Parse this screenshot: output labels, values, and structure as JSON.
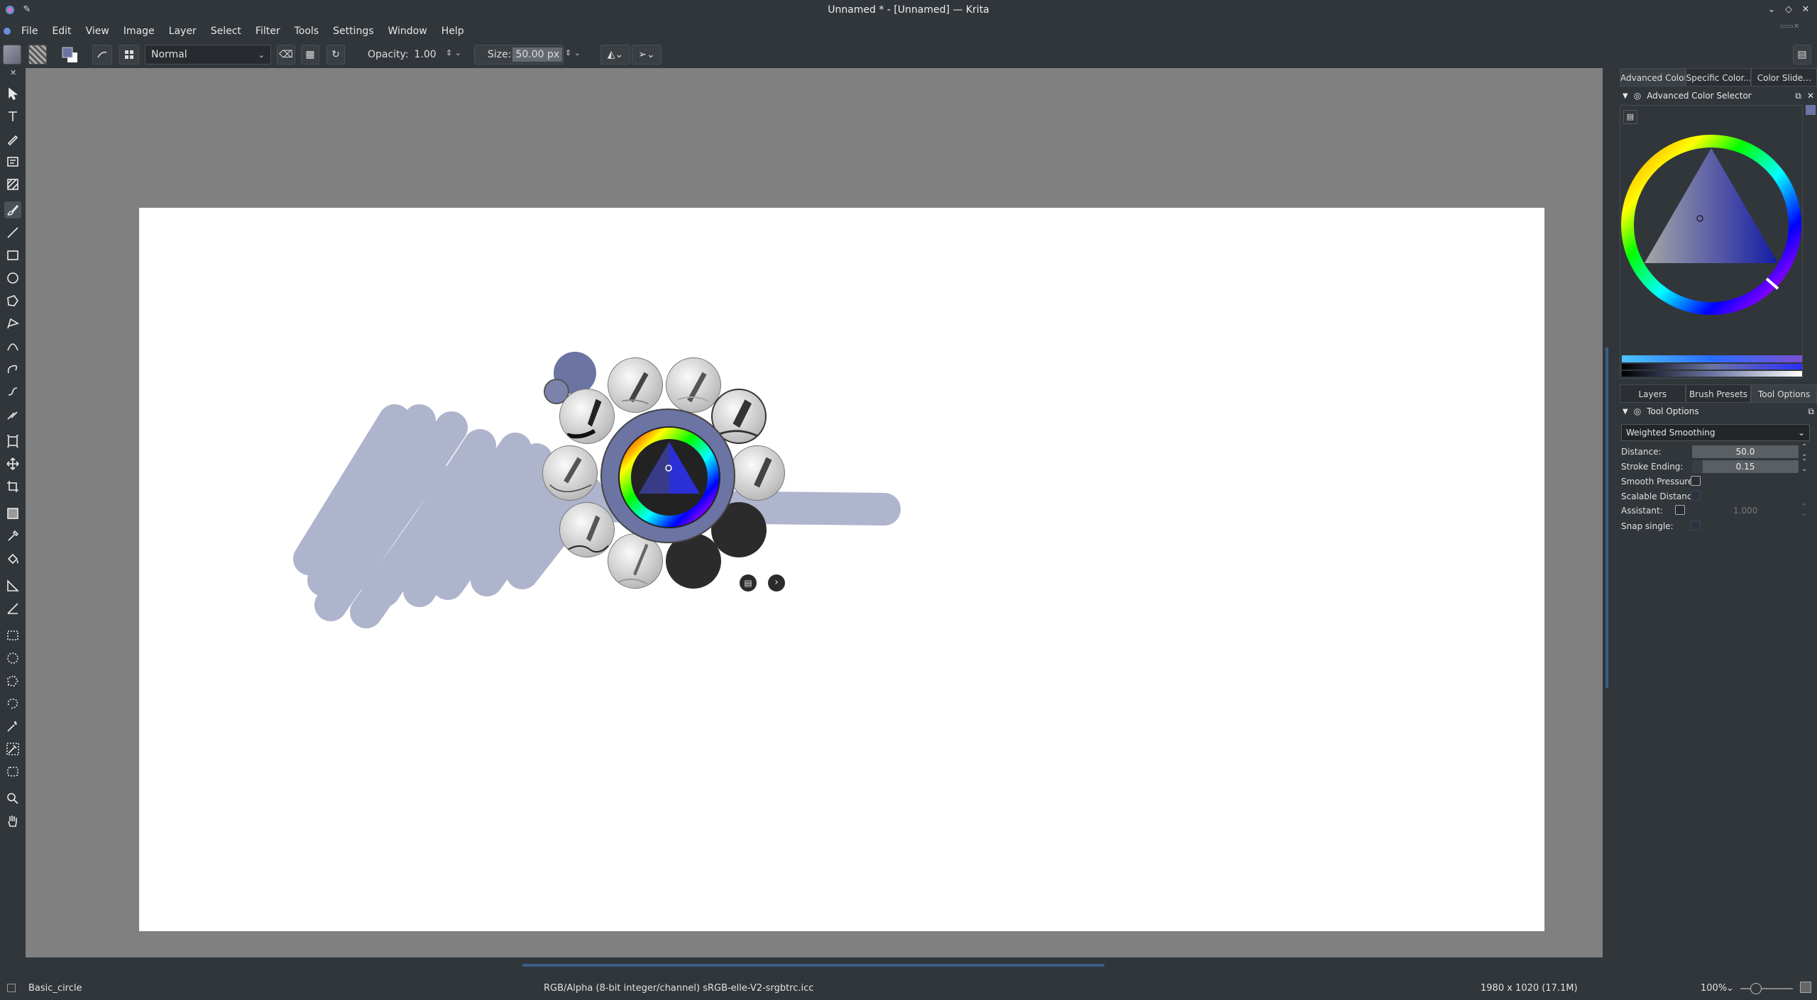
{
  "window": {
    "title": "Unnamed * - [Unnamed] — Krita"
  },
  "menu": [
    "File",
    "Edit",
    "View",
    "Image",
    "Layer",
    "Select",
    "Filter",
    "Tools",
    "Settings",
    "Window",
    "Help"
  ],
  "toolbar": {
    "blend_mode": "Normal",
    "opacity_label": "Opacity:",
    "opacity_value": "1.00",
    "size_label": "Size:",
    "size_value": "50.00 px"
  },
  "docker_tabs_top": [
    "Advanced Color...",
    "Specific Color...",
    "Color Slide..."
  ],
  "advanced_color_selector": {
    "title": "Advanced Color Selector"
  },
  "docker_tabs_mid": [
    "Layers",
    "Brush Presets",
    "Tool Options"
  ],
  "tool_options": {
    "title": "Tool Options",
    "smoothing": "Weighted Smoothing",
    "distance_label": "Distance:",
    "distance_value": "50.0",
    "stroke_ending_label": "Stroke Ending:",
    "stroke_ending_value": "0.15",
    "smooth_pressure_label": "Smooth Pressure:",
    "scalable_distance_label": "Scalable Distance:",
    "assistant_label": "Assistant:",
    "assistant_value": "1.000",
    "snap_single_label": "Snap single:"
  },
  "status": {
    "brush": "Basic_circle",
    "color_space": "RGB/Alpha (8-bit integer/channel)  sRGB-elle-V2-srgbtrc.icc",
    "dimensions": "1980 x 1020 (17.1M)",
    "zoom": "100%"
  },
  "colors": {
    "paint": "#6f78a6",
    "foreground": "#6b74a3"
  }
}
